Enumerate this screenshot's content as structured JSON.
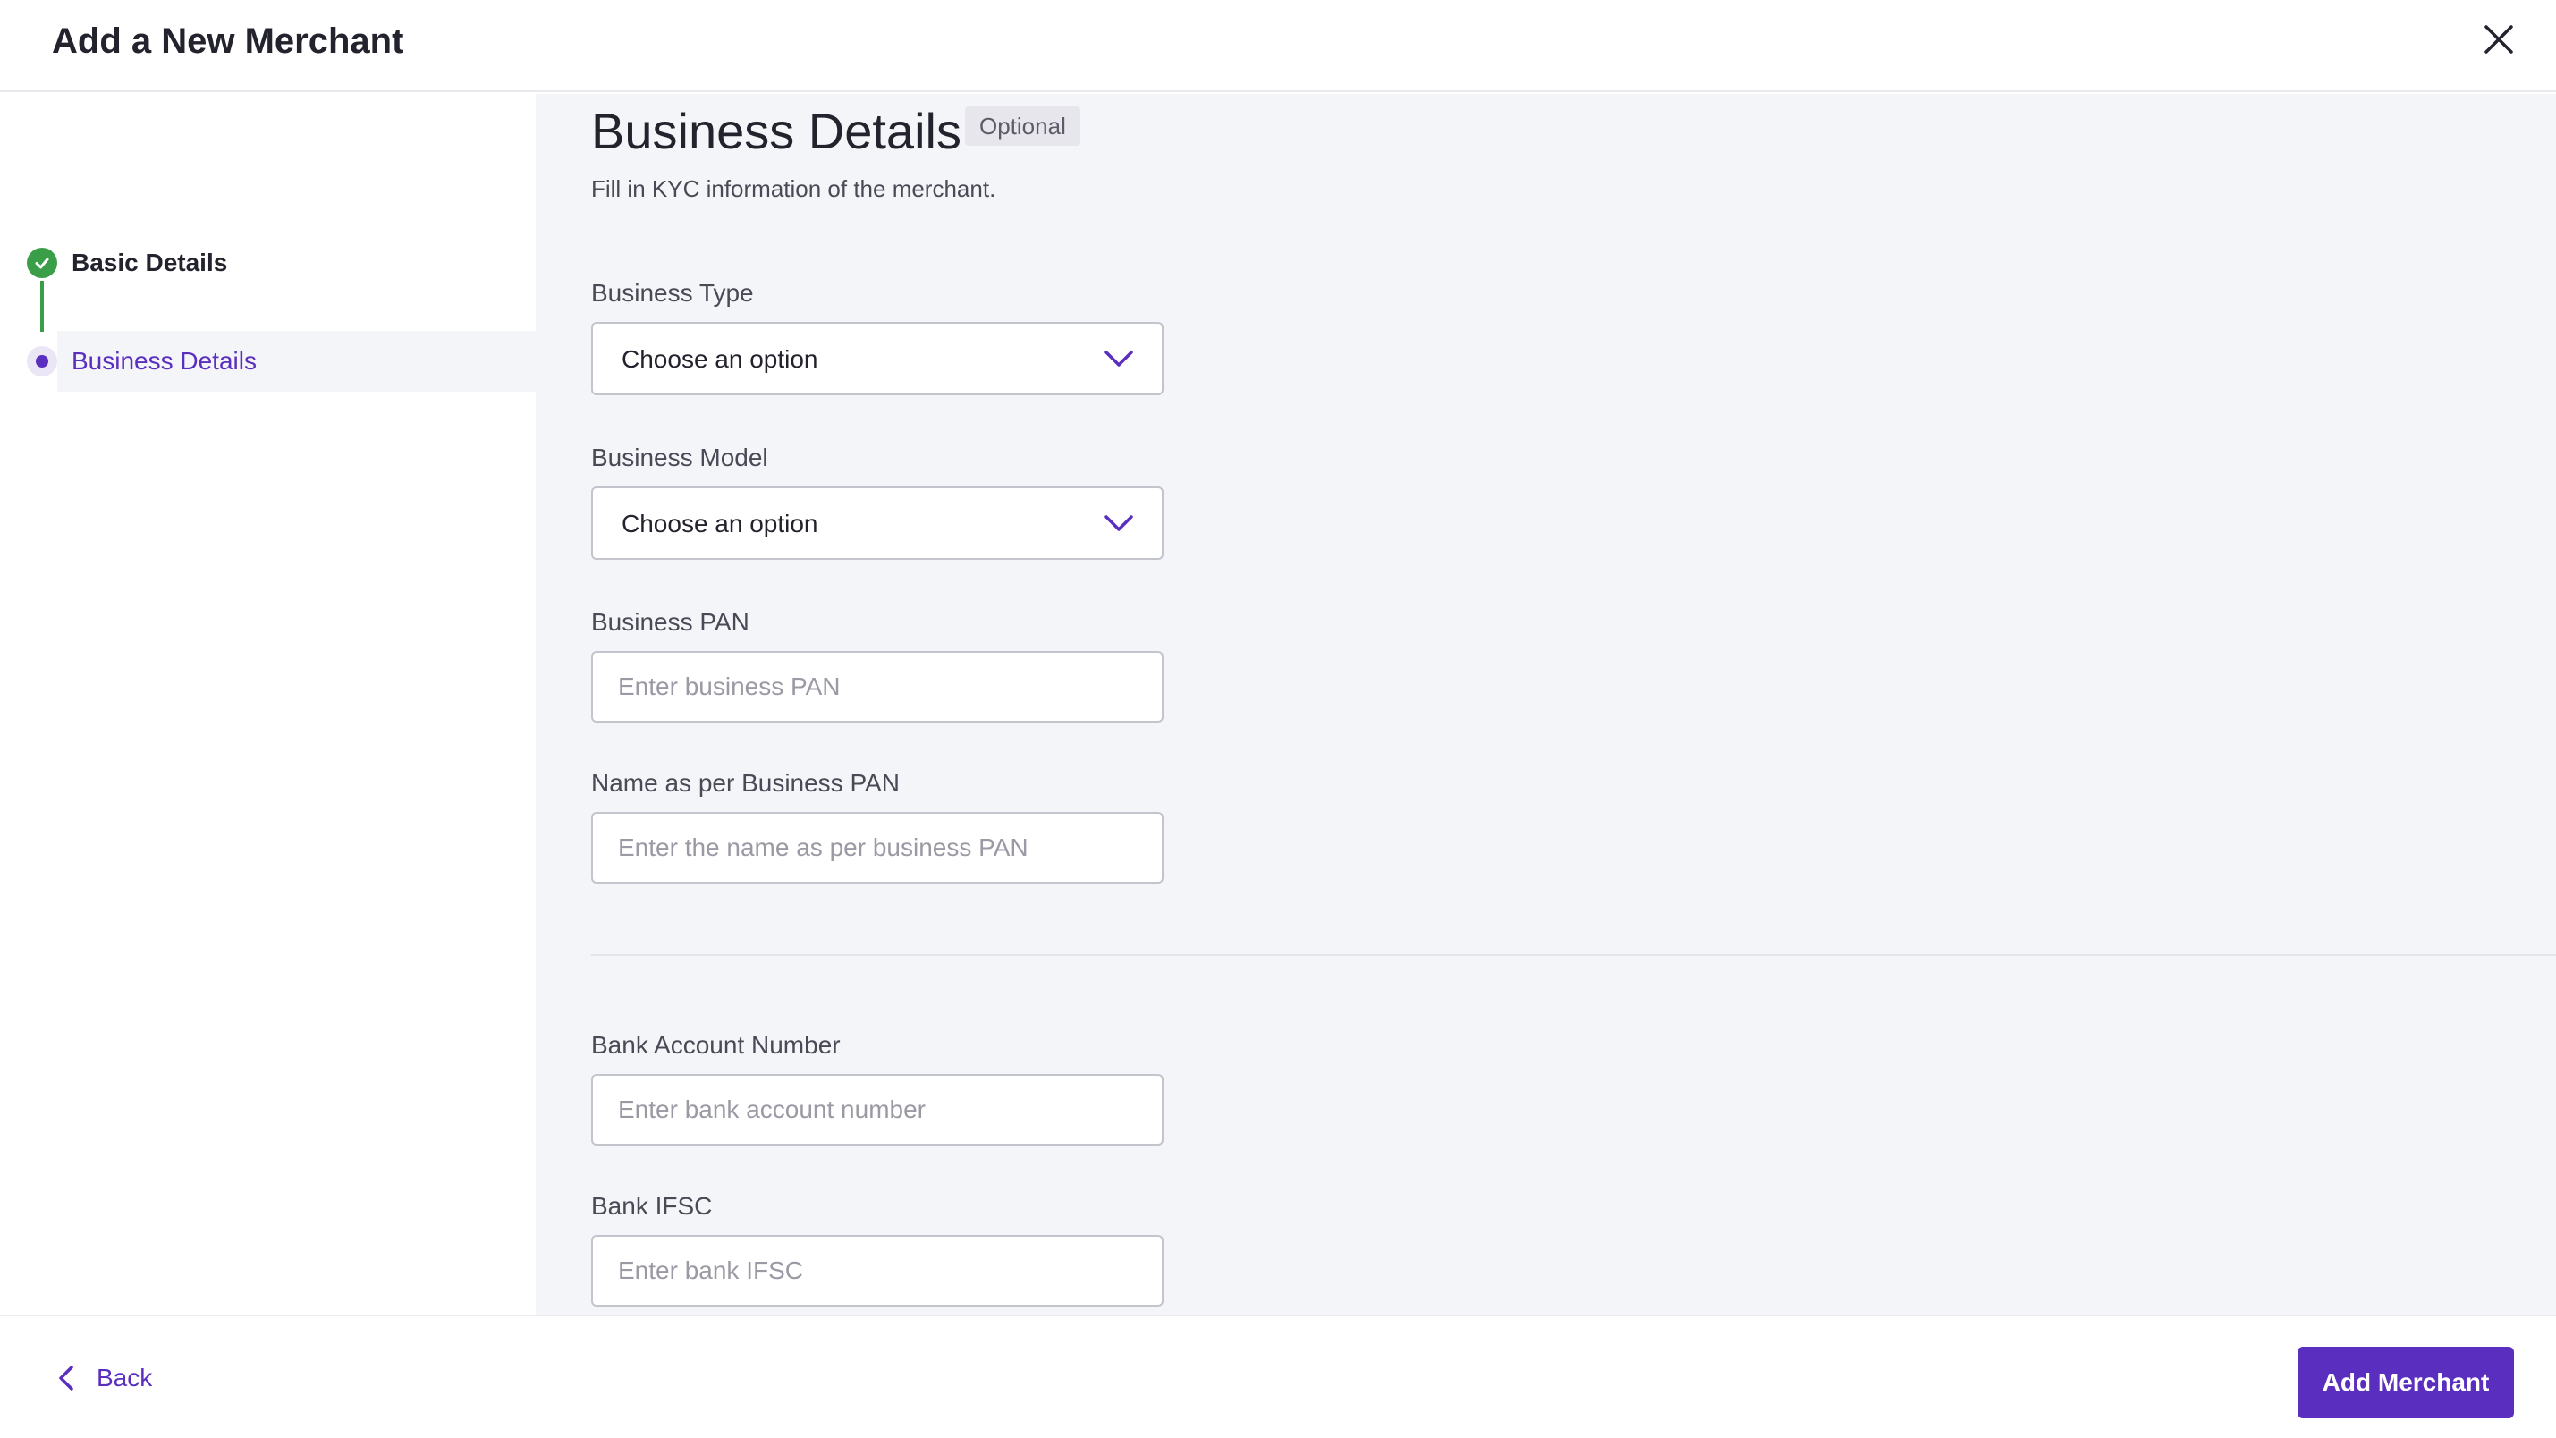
{
  "header": {
    "title": "Add a New Merchant"
  },
  "steps": [
    {
      "label": "Basic Details",
      "status": "completed"
    },
    {
      "label": "Business Details",
      "status": "active"
    }
  ],
  "section": {
    "title": "Business Details",
    "badge": "Optional",
    "description": "Fill in KYC information of the merchant."
  },
  "fields": {
    "business_type": {
      "label": "Business Type",
      "value": "Choose an option"
    },
    "business_model": {
      "label": "Business Model",
      "value": "Choose an option"
    },
    "business_pan": {
      "label": "Business PAN",
      "placeholder": "Enter business PAN"
    },
    "name_as_per_pan": {
      "label": "Name as per Business PAN",
      "placeholder": "Enter the name as per business PAN"
    },
    "bank_account_number": {
      "label": "Bank Account Number",
      "placeholder": "Enter bank account number"
    },
    "bank_ifsc": {
      "label": "Bank IFSC",
      "placeholder": "Enter bank IFSC"
    }
  },
  "footer": {
    "back_label": "Back",
    "submit_label": "Add Merchant"
  },
  "colors": {
    "accent": "#5a2fbf",
    "success": "#3a9d48",
    "panel_bg": "#f4f5f9"
  },
  "icons": {
    "close": "close-icon",
    "completed": "check-icon",
    "active": "dot-icon",
    "dropdown": "chevron-down-icon",
    "back": "chevron-left-icon"
  }
}
